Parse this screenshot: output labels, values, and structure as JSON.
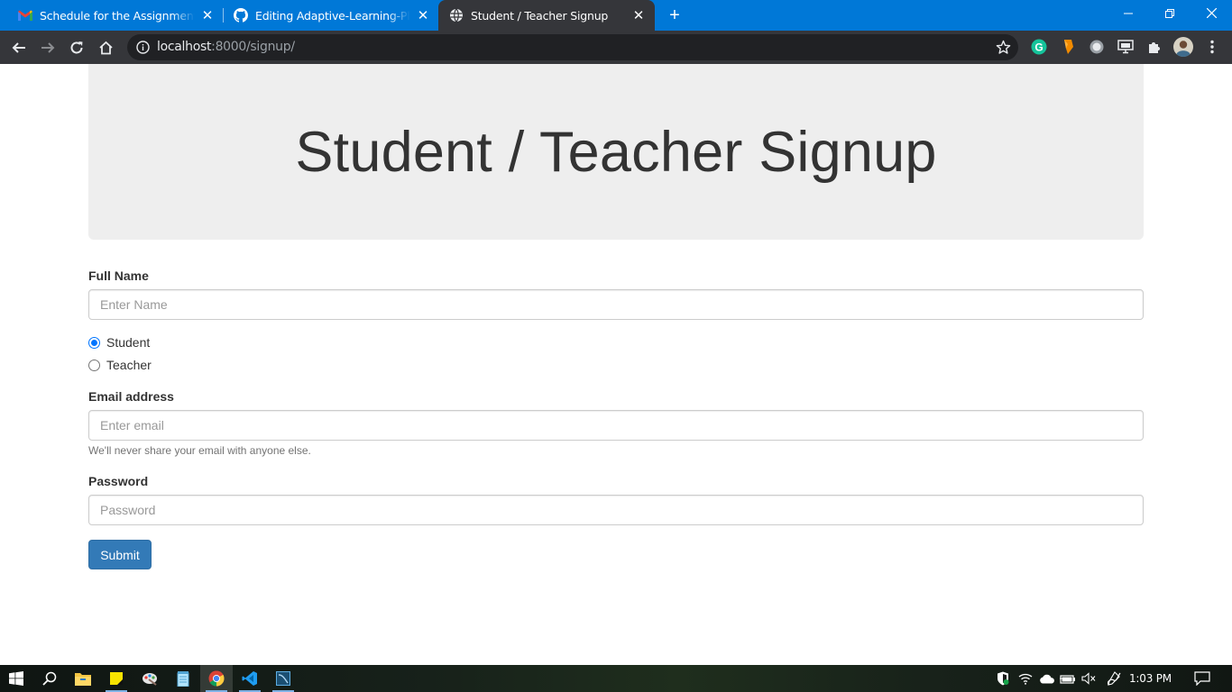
{
  "browser": {
    "tabs": [
      {
        "title": "Schedule for the Assignment of Course",
        "icon": "gmail-icon"
      },
      {
        "title": "Editing Adaptive-Learning-Platform",
        "icon": "github-icon"
      },
      {
        "title": "Student / Teacher Signup",
        "icon": "globe-icon"
      }
    ],
    "new_tab_label": "+",
    "url_host": "localhost",
    "url_rest": ":8000/signup/",
    "accent": "#0078d7"
  },
  "page": {
    "heading": "Student / Teacher Signup",
    "full_name": {
      "label": "Full Name",
      "placeholder": "Enter Name",
      "value": ""
    },
    "role_options": [
      {
        "label": "Student",
        "checked": true
      },
      {
        "label": "Teacher",
        "checked": false
      }
    ],
    "email": {
      "label": "Email address",
      "placeholder": "Enter email",
      "value": "",
      "help": "We'll never share your email with anyone else."
    },
    "password": {
      "label": "Password",
      "placeholder": "Password",
      "value": ""
    },
    "submit_label": "Submit",
    "button_color": "#337ab7"
  },
  "taskbar": {
    "apps": [
      "windows-start-icon",
      "search-icon",
      "file-explorer-icon",
      "sticky-notes-icon",
      "paint-icon",
      "notepad-icon",
      "chrome-icon",
      "vscode-icon",
      "mysql-workbench-icon"
    ],
    "time": "1:03 PM"
  }
}
